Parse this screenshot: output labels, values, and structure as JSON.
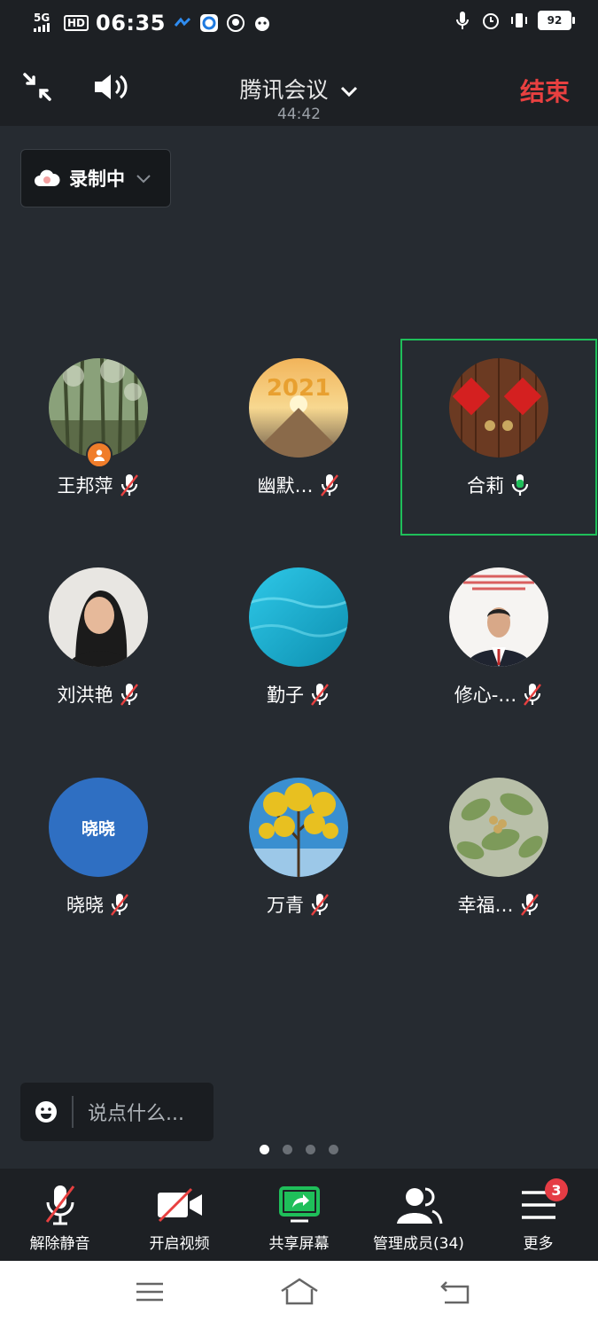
{
  "status_bar": {
    "signal": "5G",
    "hd": "HD",
    "time": "06:35",
    "battery": "92"
  },
  "header": {
    "title": "腾讯会议",
    "timer": "44:42",
    "end_label": "结束"
  },
  "recording": {
    "label": "录制中"
  },
  "participants": [
    {
      "name": "王邦萍",
      "mic": "muted",
      "host": true
    },
    {
      "name": "幽默…",
      "mic": "muted"
    },
    {
      "name": "合莉",
      "mic": "speaking",
      "active": true
    },
    {
      "name": "刘洪艳",
      "mic": "muted"
    },
    {
      "name": "勤子",
      "mic": "muted"
    },
    {
      "name": "修心-…",
      "mic": "muted"
    },
    {
      "name": "晓晓",
      "mic": "muted",
      "avatar_text": "晓晓"
    },
    {
      "name": "万青",
      "mic": "muted"
    },
    {
      "name": "幸福…",
      "mic": "muted"
    }
  ],
  "chat": {
    "placeholder": "说点什么..."
  },
  "pager": {
    "count": 4,
    "current": 0
  },
  "toolbar": {
    "unmute": "解除静音",
    "video": "开启视频",
    "share": "共享屏幕",
    "members": "管理成员(34)",
    "more": "更多",
    "more_badge": "3"
  },
  "colors": {
    "end": "#e84040",
    "speaking": "#1fbf5a",
    "share": "#1fbf5a",
    "badge": "#e53c44",
    "host_badge": "#f07d2a"
  }
}
